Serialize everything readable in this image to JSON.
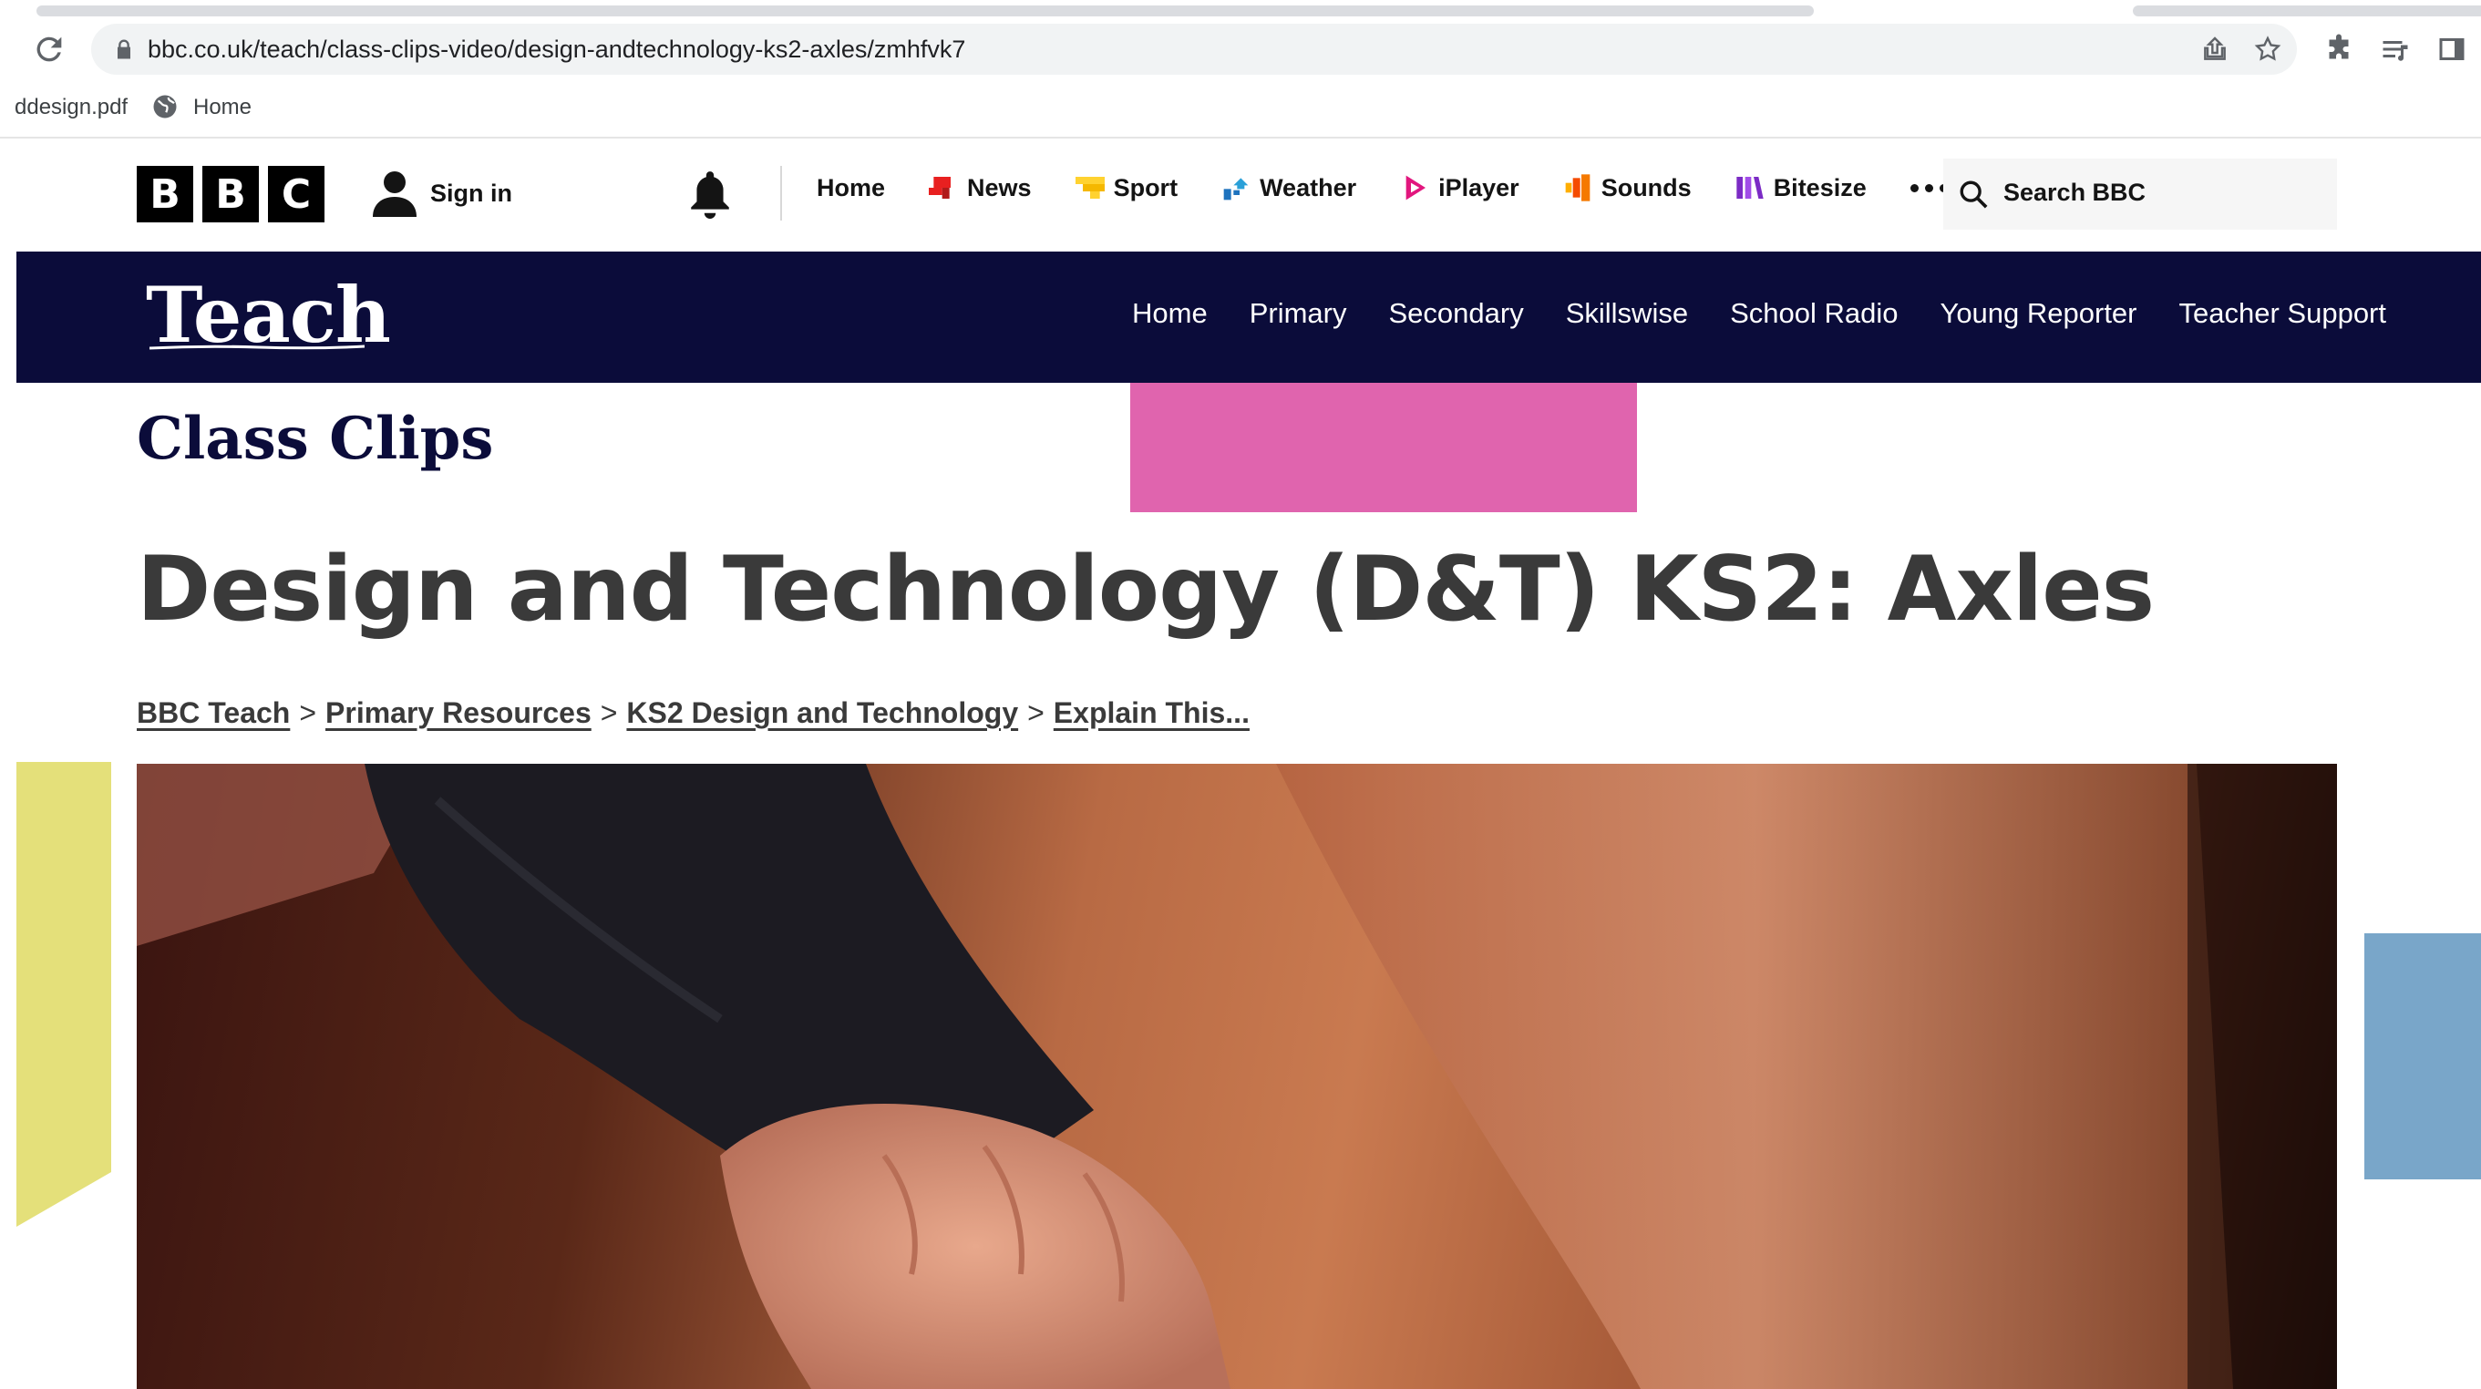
{
  "browser": {
    "url": "bbc.co.uk/teach/class-clips-video/design-andtechnology-ks2-axles/zmhfvk7",
    "bookmarks": [
      {
        "label": "ddesign.pdf"
      },
      {
        "label": "Home",
        "icon": "globe-icon"
      }
    ]
  },
  "masthead": {
    "logo_letters": [
      "B",
      "B",
      "C"
    ],
    "sign_in": "Sign in",
    "nav": [
      {
        "label": "Home"
      },
      {
        "label": "News",
        "icon": "news-icon",
        "color": "#e82020"
      },
      {
        "label": "Sport",
        "icon": "sport-icon",
        "color": "#ffd230"
      },
      {
        "label": "Weather",
        "icon": "weather-icon",
        "color": "#1e73be"
      },
      {
        "label": "iPlayer",
        "icon": "iplayer-icon",
        "color": "#e2167e"
      },
      {
        "label": "Sounds",
        "icon": "sounds-icon",
        "color": "#f54b00"
      },
      {
        "label": "Bitesize",
        "icon": "bitesize-icon",
        "color": "#7b2bc5"
      }
    ],
    "search_placeholder": "Search BBC"
  },
  "teach": {
    "logo": "Teach",
    "nav": [
      "Home",
      "Primary",
      "Secondary",
      "Skillswise",
      "School Radio",
      "Young Reporter",
      "Teacher Support"
    ]
  },
  "content": {
    "section": "Class Clips",
    "title": "Design and Technology (D&T) KS2: Axles",
    "breadcrumbs": [
      "BBC Teach",
      "Primary Resources",
      "KS2 Design and Technology",
      "Explain This..."
    ],
    "breadcrumb_separator": ">"
  },
  "colors": {
    "teach_bar": "#0b0c3a",
    "pink_block": "#e064ae",
    "yellow_shape": "#e4e07a",
    "blue_block": "#79a6c9"
  }
}
